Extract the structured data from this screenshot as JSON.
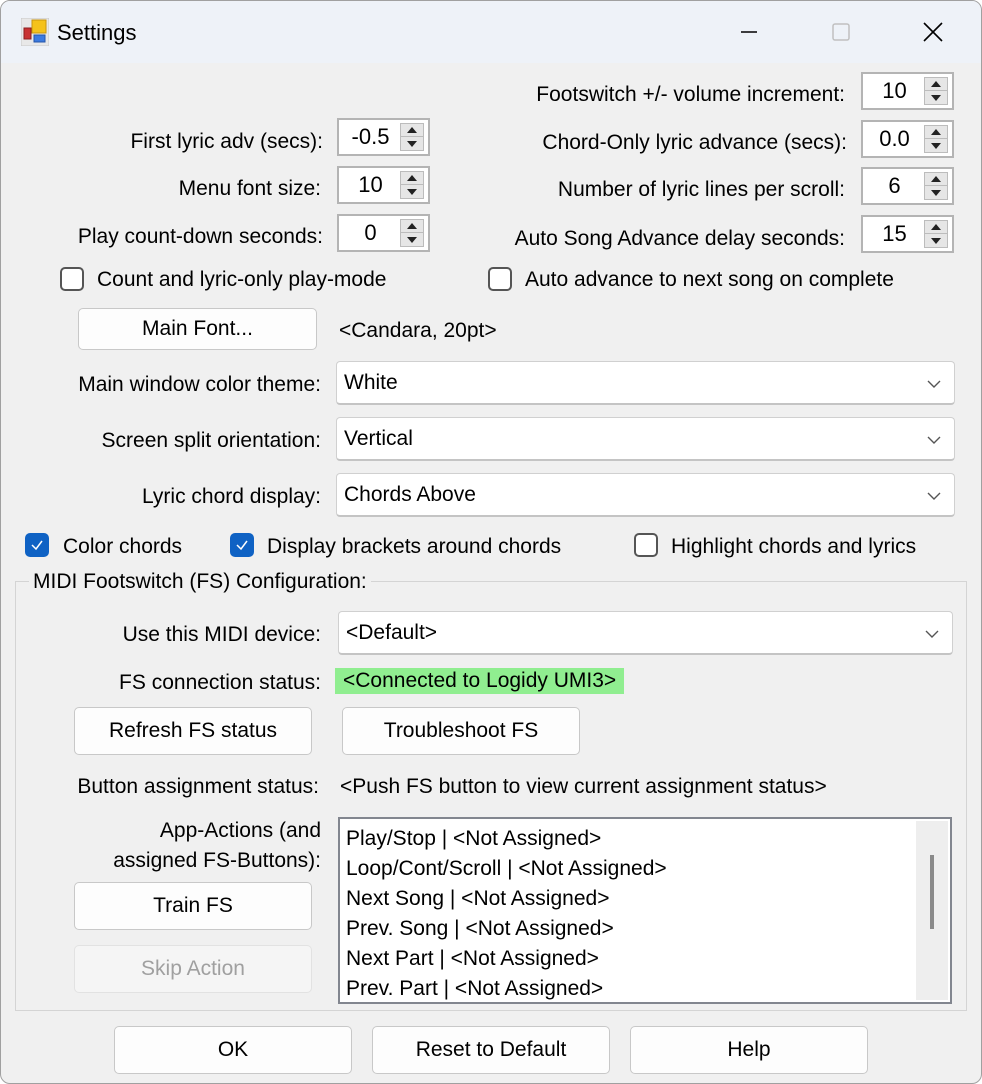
{
  "window": {
    "title": "Settings",
    "icon": "app-settings-icon",
    "controls": {
      "minimize": "minimize-icon",
      "maximize": "maximize-icon",
      "close": "close-icon"
    }
  },
  "spinners_left": [
    {
      "label": "First lyric adv (secs):",
      "value": "-0.5"
    },
    {
      "label": "Menu font size:",
      "value": "10"
    },
    {
      "label": "Play count-down seconds:",
      "value": "0"
    }
  ],
  "spinners_right": [
    {
      "label": "Footswitch +/- volume increment:",
      "value": "10"
    },
    {
      "label": "Chord-Only lyric advance (secs):",
      "value": "0.0"
    },
    {
      "label": "Number of lyric lines per scroll:",
      "value": "6"
    },
    {
      "label": "Auto Song Advance delay seconds:",
      "value": "15"
    }
  ],
  "checkboxes_top": [
    {
      "label": "Count and lyric-only play-mode",
      "checked": false
    },
    {
      "label": "Auto advance to next song on complete",
      "checked": false
    }
  ],
  "main_font": {
    "button_label": "Main Font...",
    "value": "<Candara, 20pt>"
  },
  "combos": [
    {
      "label": "Main window color theme:",
      "value": "White"
    },
    {
      "label": "Screen split orientation:",
      "value": "Vertical"
    },
    {
      "label": "Lyric chord display:",
      "value": "Chords Above"
    }
  ],
  "checkboxes_chords": [
    {
      "label": "Color chords",
      "checked": true
    },
    {
      "label": "Display brackets around chords",
      "checked": true
    },
    {
      "label": "Highlight chords and lyrics",
      "checked": false
    }
  ],
  "midi": {
    "group_title": "MIDI Footswitch (FS) Configuration:",
    "device_label": "Use this MIDI device:",
    "device_value": "<Default>",
    "status_label": "FS connection status:",
    "status_value": "<Connected to Logidy UMI3>",
    "status_color": "#90ee90",
    "refresh_button": "Refresh FS status",
    "troubleshoot_button": "Troubleshoot FS",
    "assignment_label": "Button assignment status:",
    "assignment_value": "<Push FS button to view current assignment status>",
    "actions_label_1": "App-Actions (and",
    "actions_label_2": "assigned FS-Buttons):",
    "train_button": "Train FS",
    "skip_button": "Skip Action",
    "actions": [
      "Play/Stop | <Not Assigned>",
      "Loop/Cont/Scroll | <Not Assigned>",
      "Next Song | <Not Assigned>",
      "Prev. Song | <Not Assigned>",
      "Next Part | <Not Assigned>",
      "Prev. Part | <Not Assigned>"
    ]
  },
  "footer": {
    "ok": "OK",
    "reset": "Reset to Default",
    "help": "Help"
  },
  "colors": {
    "checkbox_accent": "#0f62c4",
    "titlebar_bg": "#eef2f8",
    "dialog_bg": "#f0f0f0"
  }
}
